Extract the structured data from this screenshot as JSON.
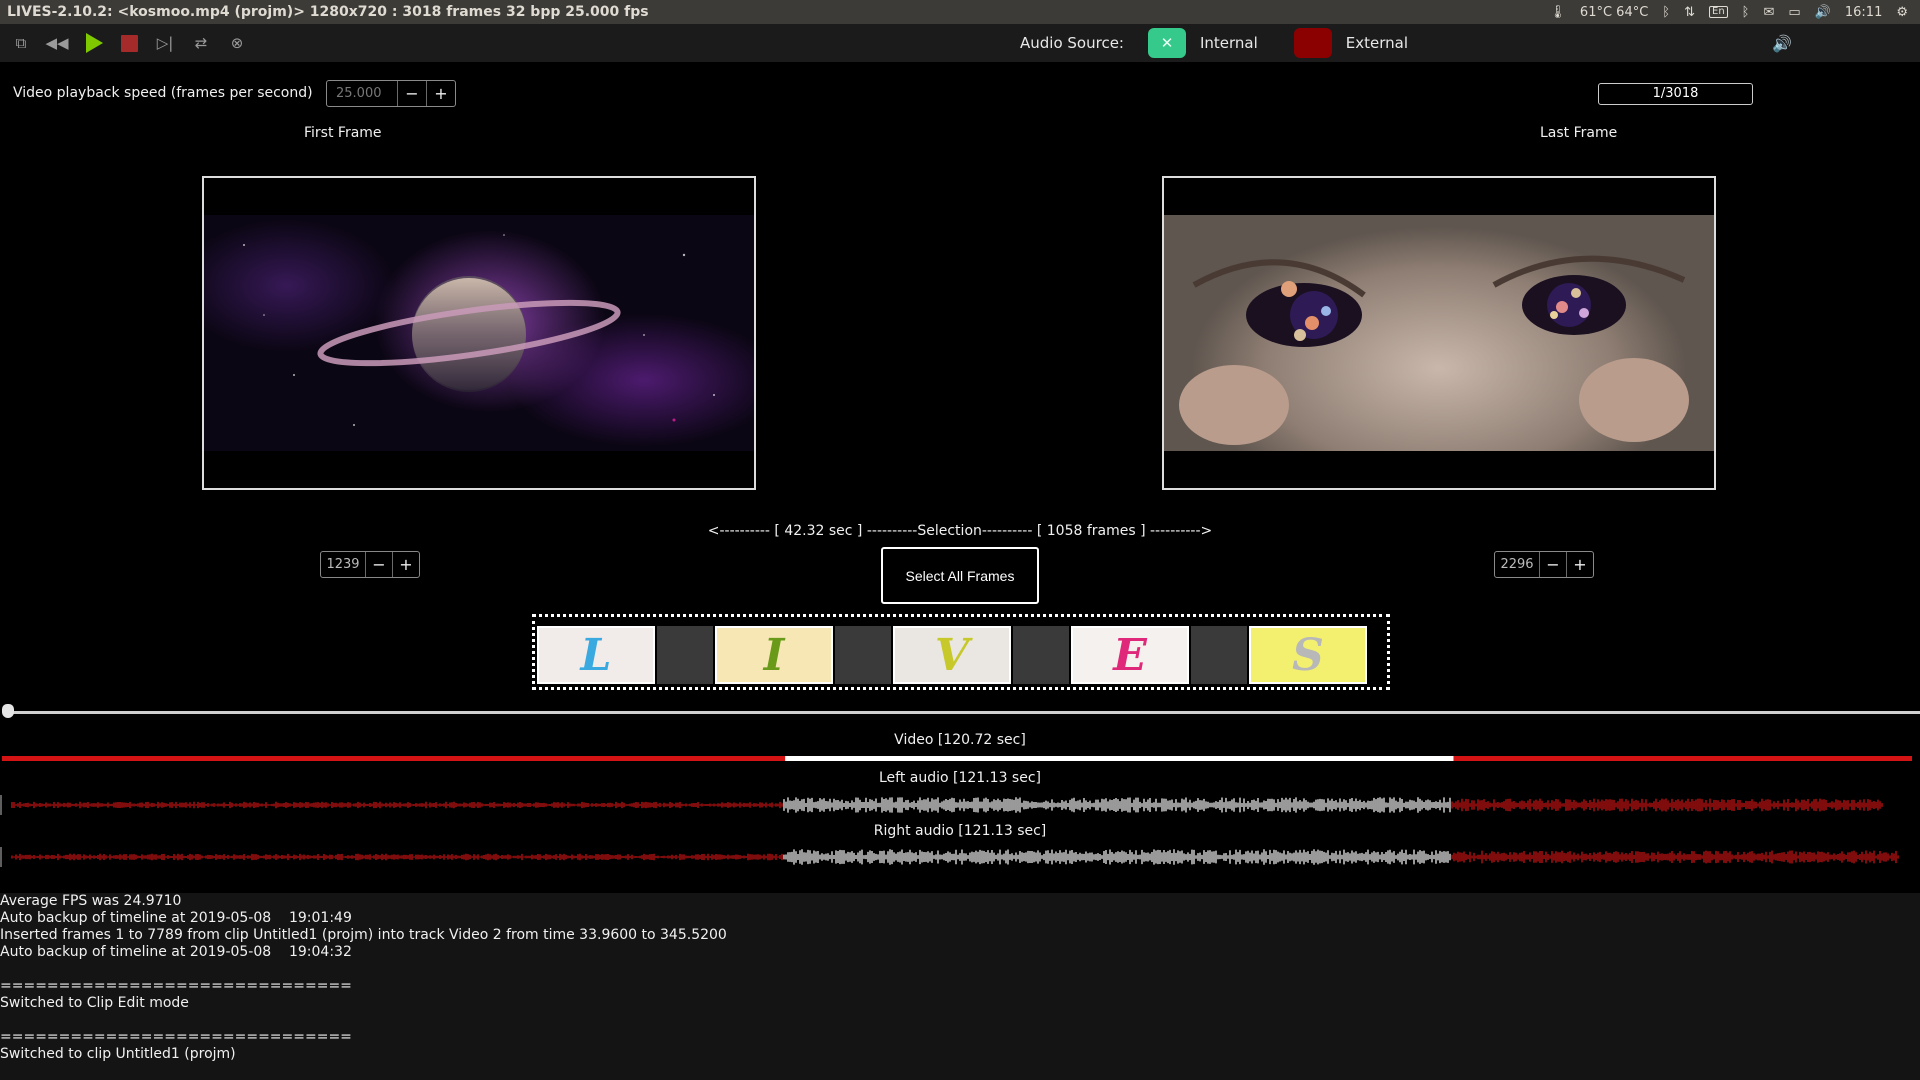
{
  "window": {
    "title": "LIVES-2.10.2: <kosmoo.mp4 (projm)> 1280x720 : 3018 frames 32 bpp 25.000 fps"
  },
  "tray": {
    "temperature": "61°C 64°C",
    "keyboard": "En",
    "clock": "16:11"
  },
  "toolbar": {
    "audio_source_label": "Audio Source:",
    "internal_label": "Internal",
    "external_label": "External",
    "internal_color": "#35c98b",
    "external_color": "#8b0000"
  },
  "speed": {
    "label": "Video playback speed (frames per second)",
    "value": "25.000",
    "minus": "−",
    "plus": "+"
  },
  "frame_counter": "1/3018",
  "frames": {
    "first_label": "First Frame",
    "last_label": "Last Frame",
    "start_value": "1239",
    "end_value": "2296"
  },
  "selection": {
    "text": "<---------- [ 42.32 sec ] ----------Selection---------- [ 1058 frames ] ---------->",
    "select_all_label": "Select All Frames"
  },
  "filmstrip": {
    "letters": [
      "L",
      "I",
      "V",
      "E",
      "S"
    ]
  },
  "timeline": {
    "video_label": "Video [120.72 sec]",
    "left_audio_label": "Left audio [121.13 sec]",
    "right_audio_label": "Right audio [121.13 sec]",
    "selection_start_fraction": 0.41,
    "selection_end_fraction": 0.76,
    "track_color": "#d41414",
    "selected_color": "#ffffff"
  },
  "log": [
    "Average FPS was 24.9710",
    "Auto backup of timeline at 2019-05-08    19:01:49",
    "Inserted frames 1 to 7789 from clip Untitled1 (projm) into track Video 2 from time 33.9600 to 345.5200",
    "Auto backup of timeline at 2019-05-08    19:04:32",
    "",
    "==============================",
    "Switched to Clip Edit mode",
    "",
    "==============================",
    "Switched to clip Untitled1 (projm)"
  ]
}
